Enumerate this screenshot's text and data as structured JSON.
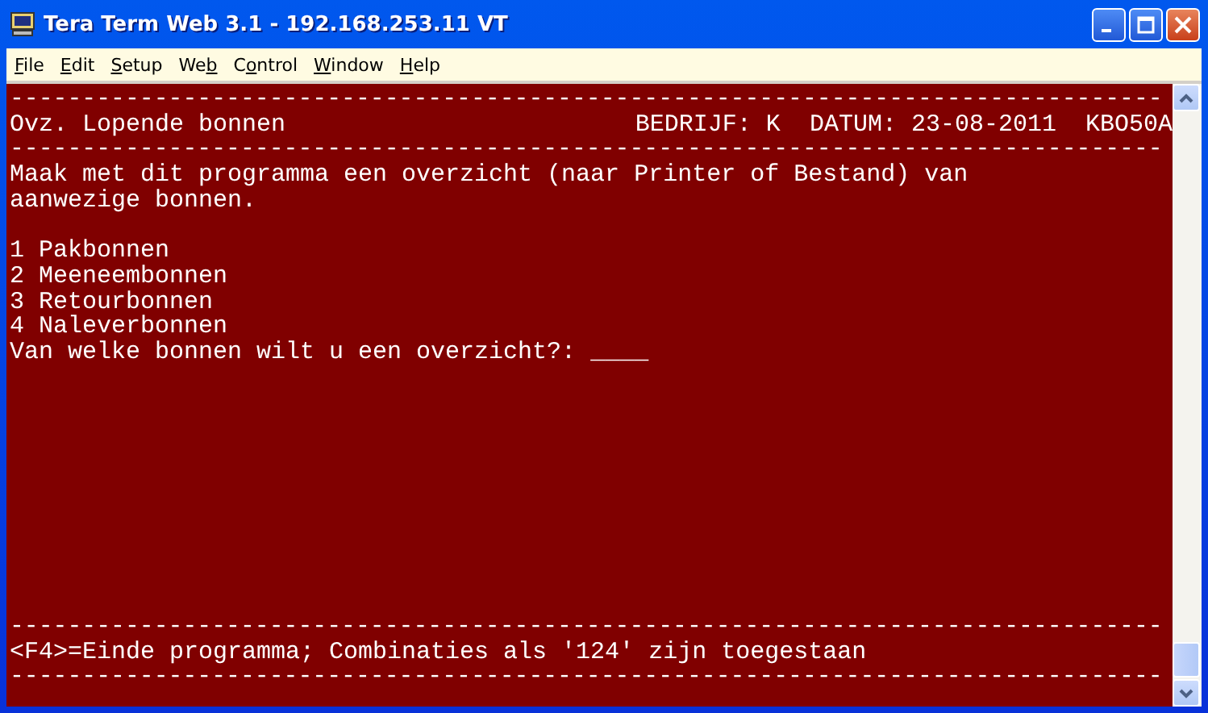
{
  "window": {
    "title": "Tera Term Web 3.1 - 192.168.253.11 VT"
  },
  "menu": [
    {
      "key": "F",
      "post": "ile"
    },
    {
      "key": "E",
      "post": "dit"
    },
    {
      "key": "S",
      "post": "etup"
    },
    {
      "pre": "We",
      "key": "b"
    },
    {
      "pre": "C",
      "key": "o",
      "post": "ntrol"
    },
    {
      "key": "W",
      "post": "indow"
    },
    {
      "key": "H",
      "post": "elp"
    }
  ],
  "terminal": {
    "top_rule": "--------------------------------------------------------------------------------",
    "header": {
      "title": "Ovz. Lopende bonnen",
      "company": "BEDRIJF: K",
      "date": "DATUM: 23-08-2011",
      "code": "KBO50A"
    },
    "header_rule": "--------------------------------------------------------------------------------",
    "intro": [
      "Maak met dit programma een overzicht (naar Printer of Bestand) van",
      "aanwezige bonnen."
    ],
    "options": [
      "1 Pakbonnen",
      "2 Meeneembonnen",
      "3 Retourbonnen",
      "4 Naleverbonnen"
    ],
    "prompt": "Van welke bonnen wilt u een overzicht?:",
    "field": "____",
    "footer_rule": "--------------------------------------------------------------------------------",
    "footer": "<F4>=Einde programma; Combinaties als '124' zijn toegestaan",
    "bottom_rule": "--------------------------------------------------------------------------------"
  }
}
